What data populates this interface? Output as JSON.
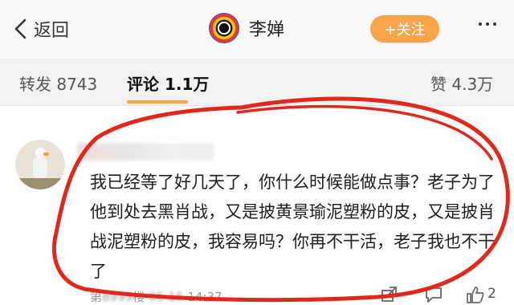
{
  "header": {
    "back_label": "返回",
    "account_name": "李婵",
    "follow_label": "+关注"
  },
  "tabs": [
    {
      "label": "转发 8743"
    },
    {
      "label": "评论 1.1万"
    },
    {
      "label": "赞 4.3万"
    }
  ],
  "active_tab": 1,
  "comment": {
    "text": "我已经等了好几天了，你什么时候能做点事？老子为了他到处去黑肖战，又是披黄景瑜泥塑粉的皮，又是披肖战泥塑粉的皮，我容易吗？你再不干活，老子我也不干了",
    "floor_prefix": "第",
    "floor_suffix": "楼",
    "time": "14:37",
    "like_count": "2"
  },
  "colors": {
    "accent": "#f7a44a",
    "annotation_red": "#e0281c"
  },
  "icons": [
    "chevron-left-icon",
    "more-dots-icon",
    "share-icon",
    "comment-icon",
    "like-icon"
  ]
}
